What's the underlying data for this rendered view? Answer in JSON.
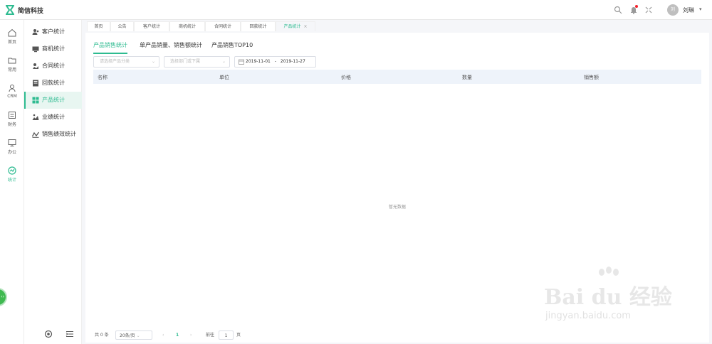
{
  "app": {
    "title": "简信科技"
  },
  "user": {
    "name": "刘琳",
    "avatar_text": "刘"
  },
  "rail": [
    {
      "label": "首页",
      "icon": "home-icon"
    },
    {
      "label": "常用",
      "icon": "folder-icon"
    },
    {
      "label": "CRM",
      "icon": "crm-icon"
    },
    {
      "label": "财务",
      "icon": "finance-icon"
    },
    {
      "label": "办公",
      "icon": "monitor-icon"
    },
    {
      "label": "统计",
      "icon": "stats-icon",
      "active": true
    }
  ],
  "submenu": [
    {
      "label": "客户统计",
      "icon": "customer-icon"
    },
    {
      "label": "商机统计",
      "icon": "opportunity-icon"
    },
    {
      "label": "合同统计",
      "icon": "contract-icon"
    },
    {
      "label": "回款统计",
      "icon": "payment-icon"
    },
    {
      "label": "产品统计",
      "icon": "product-icon",
      "active": true
    },
    {
      "label": "业绩统计",
      "icon": "performance-icon"
    },
    {
      "label": "销售绩效统计",
      "icon": "sales-performance-icon"
    }
  ],
  "tabs": [
    {
      "label": "首页"
    },
    {
      "label": "公告"
    },
    {
      "label": "客户统计"
    },
    {
      "label": "商机统计"
    },
    {
      "label": "合同统计"
    },
    {
      "label": "回款统计"
    },
    {
      "label": "产品统计",
      "active": true,
      "close": "×"
    }
  ],
  "sub_tabs": [
    {
      "label": "产品销售统计",
      "active": true
    },
    {
      "label": "单产品销量、销售额统计"
    },
    {
      "label": "产品销售TOP10"
    }
  ],
  "filters": {
    "category_placeholder": "请选择产品分类",
    "department_placeholder": "选择部门或下属",
    "date_start": "2019-11-01",
    "date_sep": "-",
    "date_end": "2019-11-27"
  },
  "table": {
    "columns": [
      "名称",
      "单位",
      "价格",
      "数量",
      "销售额"
    ],
    "empty_text": "暂无数据"
  },
  "pager": {
    "total": "共 0 条",
    "page_size": "20条/页",
    "current_page": "1",
    "goto_label": "前往",
    "goto_value": "1",
    "page_suffix": "页"
  },
  "watermark": {
    "line1": "Bai du 经验",
    "line2": "jingyan.baidu.com"
  },
  "colors": {
    "accent": "#2dbb90",
    "header_bg": "#eef3fa"
  }
}
